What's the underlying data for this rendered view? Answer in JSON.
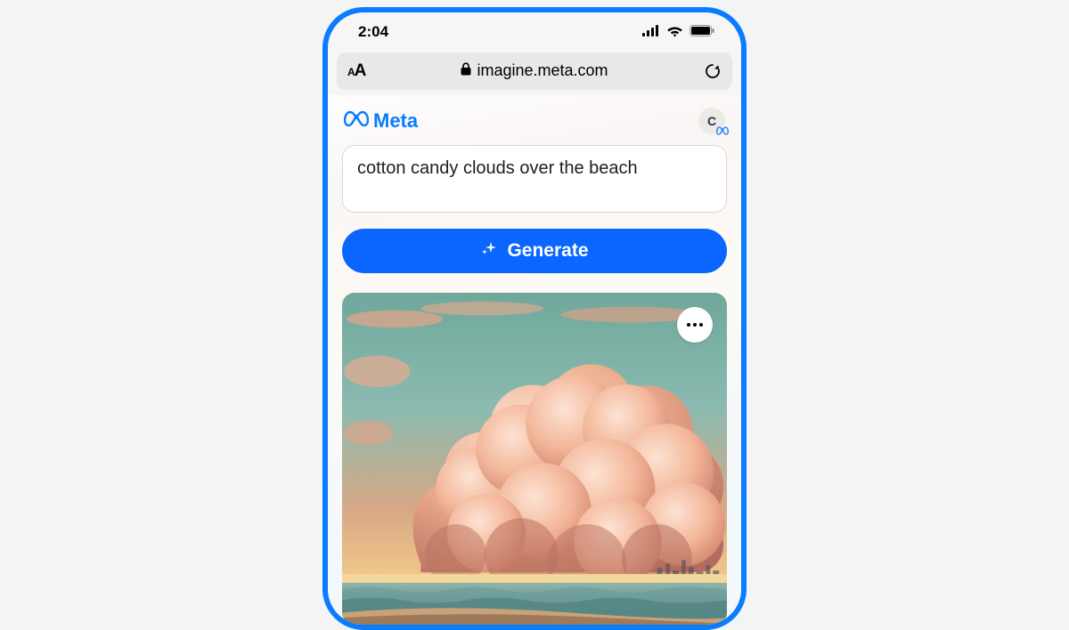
{
  "status": {
    "time": "2:04"
  },
  "url_bar": {
    "domain": "imagine.meta.com"
  },
  "brand": {
    "name": "Meta"
  },
  "avatar": {
    "initial": "C"
  },
  "prompt": {
    "value": "cotton candy clouds over the beach"
  },
  "actions": {
    "generate_label": "Generate"
  }
}
